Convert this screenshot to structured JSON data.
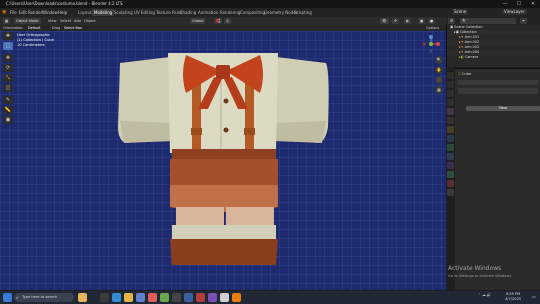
{
  "window": {
    "title": "C:\\Users\\User\\Downloads\\costume.blend - Blender 4.2 LTS",
    "controls": [
      "—",
      "☐",
      "✕"
    ]
  },
  "menu": {
    "items": [
      "File",
      "Edit",
      "Render",
      "Window",
      "Help"
    ],
    "workspaces": [
      "Layout",
      "Modeling",
      "Sculpting",
      "UV Editing",
      "Texture Paint",
      "Shading",
      "Animation",
      "Rendering",
      "Compositing",
      "Geometry Nodes",
      "Scripting"
    ],
    "active_workspace": "Modeling",
    "scene_label": "Scene",
    "view_layer_label": "ViewLayer"
  },
  "header": {
    "mode": "Object Mode",
    "menus": [
      "View",
      "Select",
      "Add",
      "Object"
    ],
    "pivot": "Global",
    "orientation": "Default",
    "drag": "Drag",
    "select_box": "Select Box",
    "options": "Options"
  },
  "viewport": {
    "info_lines": [
      "User Orthographic",
      "(1) Collection | Cube",
      "10 Centimeters"
    ]
  },
  "toolbar": {
    "tools": [
      "cursor-icon",
      "select-icon",
      "move-icon",
      "rotate-icon",
      "scale-icon",
      "transform-icon",
      "annotate-icon",
      "measure-icon",
      "add-cube-icon"
    ],
    "active_index": 1
  },
  "outliner": {
    "title": "Scene Collection",
    "rows": [
      {
        "label": "Collection",
        "indent": 1
      },
      {
        "label": "Arm.001",
        "indent": 2
      },
      {
        "label": "Arm.002",
        "indent": 2
      },
      {
        "label": "Arm.003",
        "indent": 2
      },
      {
        "label": "Arm.004",
        "indent": 2
      },
      {
        "label": "Camera",
        "indent": 2
      }
    ]
  },
  "properties": {
    "object_name": "Cube",
    "new_button": "New"
  },
  "watermark": {
    "line1": "Activate Windows",
    "line2": "Go to Settings to activate Windows."
  },
  "taskbar": {
    "search_placeholder": "Type here to search",
    "time": "9:55 PM",
    "date": "4/7/2025"
  },
  "colors": {
    "viewport_bg": "#1e2a6e",
    "shirt": "#d9d7c0",
    "bow": "#c2431c",
    "suspenders": "#b45a25",
    "shorts": "#a5502c",
    "accent": "#4772b3"
  }
}
